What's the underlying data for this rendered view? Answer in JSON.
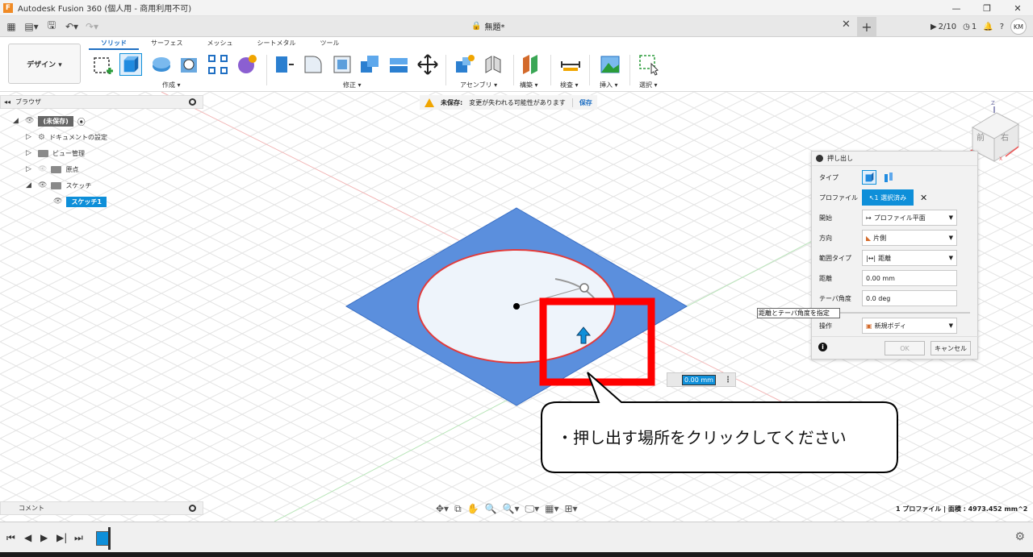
{
  "window": {
    "title": "Autodesk Fusion 360 (個人用 - 商用利用不可)",
    "app_icon": "F"
  },
  "tabbar": {
    "doc_title": "無題*",
    "jobs": "2/10",
    "clock_count": "1",
    "user_initials": "KM"
  },
  "ribbon": {
    "workspace": "デザイン ▾",
    "tabs": [
      "ソリッド",
      "サーフェス",
      "メッシュ",
      "シートメタル",
      "ツール"
    ],
    "groups": {
      "create": "作成 ▾",
      "modify": "修正 ▾",
      "assemble": "アセンブリ ▾",
      "construct": "構築 ▾",
      "inspect": "検査 ▾",
      "insert": "挿入 ▾",
      "select": "選択 ▾"
    }
  },
  "browser": {
    "header": "ブラウザ",
    "root": "(未保存)",
    "items": [
      {
        "label": "ドキュメントの設定"
      },
      {
        "label": "ビュー管理"
      },
      {
        "label": "原点"
      },
      {
        "label": "スケッチ"
      }
    ],
    "sketch": "スケッチ1"
  },
  "warning": {
    "title": "未保存:",
    "message": "変更が失われる可能性があります",
    "save": "保存"
  },
  "extrude": {
    "title": "押し出し",
    "rows": {
      "type": "タイプ",
      "profile": "プロファイル",
      "profile_value": "1 選択済み",
      "start": "開始",
      "start_value": "プロファイル平面",
      "direction": "方向",
      "direction_value": "片側",
      "extent": "範囲タイプ",
      "extent_value": "距離",
      "distance": "距離",
      "distance_value": "0.00 mm",
      "taper": "テーパ角度",
      "taper_value": "0.0 deg",
      "operation": "操作",
      "operation_value": "新規ボディ"
    },
    "ok": "OK",
    "cancel": "キャンセル",
    "tooltip": "距離とテーパ角度を指定"
  },
  "canvas": {
    "distance_input": "0.00 mm",
    "viewcube": {
      "front": "前",
      "right": "右"
    }
  },
  "callout": {
    "text": "・押し出す場所をクリックしてください"
  },
  "status": {
    "comment": "コメント",
    "profile_info": "1 プロファイル | 面積 : 4973.452 mm^2"
  },
  "colors": {
    "accent": "#0e8fd9",
    "plane": "#5b8fdd",
    "highlight_red": "#ff0000"
  }
}
